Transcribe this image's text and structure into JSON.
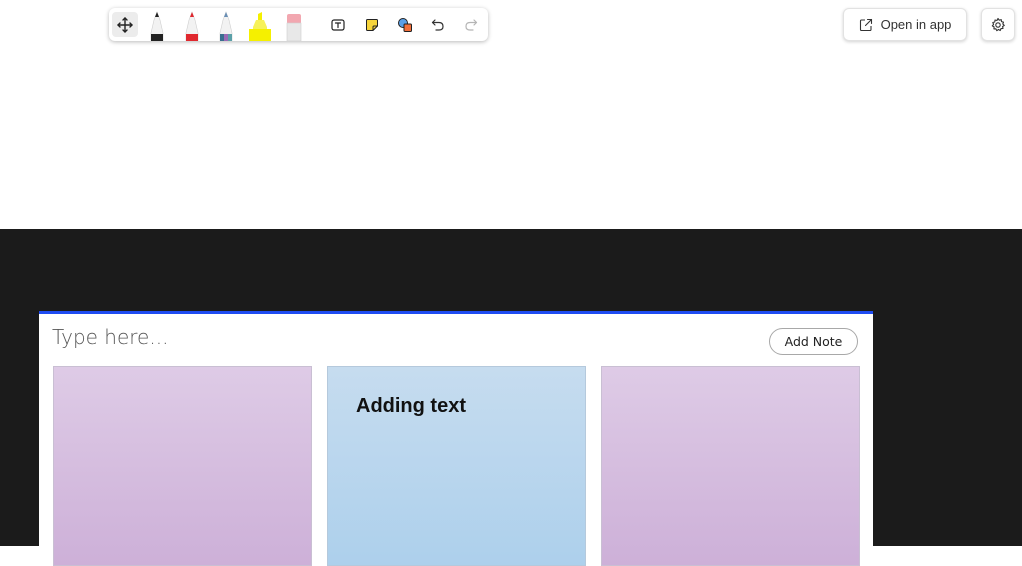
{
  "toolbar": {
    "tools": [
      {
        "name": "move",
        "icon": "move-icon"
      },
      {
        "name": "black-pen",
        "icon": "pen-icon",
        "color": "#222222"
      },
      {
        "name": "red-pen",
        "icon": "pen-icon",
        "color": "#e0282e"
      },
      {
        "name": "galaxy-pen",
        "icon": "pen-icon",
        "color": "#6a8fb5"
      },
      {
        "name": "highlighter",
        "icon": "highlighter-icon",
        "color": "#f5f000"
      },
      {
        "name": "eraser",
        "icon": "eraser-icon",
        "color": "#f2a7b0"
      },
      {
        "name": "text",
        "icon": "text-box-icon"
      },
      {
        "name": "sticky-note",
        "icon": "sticky-note-icon",
        "color": "#f7d53c"
      },
      {
        "name": "shapes",
        "icon": "shapes-icon",
        "color": "#f26f3a"
      },
      {
        "name": "undo",
        "icon": "undo-icon"
      },
      {
        "name": "redo",
        "icon": "redo-icon"
      }
    ]
  },
  "header": {
    "open_in_app_label": "Open in app",
    "open_in_app_icon": "open-external-icon",
    "settings_icon": "gear-icon"
  },
  "notes_panel": {
    "input_placeholder": "Type here...",
    "add_note_label": "Add Note",
    "accent_color": "#1f4cf2",
    "notes": [
      {
        "text": "",
        "color": "purple"
      },
      {
        "text": "Adding text",
        "color": "blue"
      },
      {
        "text": "",
        "color": "purple"
      }
    ]
  }
}
